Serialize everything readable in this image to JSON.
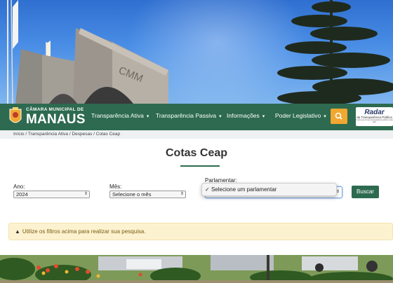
{
  "hero": {
    "building_sign": "CMM"
  },
  "header": {
    "logo": {
      "line1": "CÂMARA MUNICIPAL DE",
      "line2": "MANAUS"
    },
    "nav": [
      {
        "label": "Transparência Ativa"
      },
      {
        "label": "Transparência Passiva"
      },
      {
        "label": "Informações"
      },
      {
        "label": "Poder Legislativo"
      }
    ],
    "radar": {
      "title": "Radar",
      "subtitle": "da Transparência Pública",
      "tagline": "O site que torna a transparência pública mais fácil"
    }
  },
  "breadcrumb": "Início / Transparência Ativa / Despesas / Cotas Ceap",
  "page_title": "Cotas Ceap",
  "filters": {
    "ano": {
      "label": "Ano:",
      "value": "2024"
    },
    "mes": {
      "label": "Mês:",
      "value": "Selecione o mês"
    },
    "parlamentar": {
      "label": "Parlamentar:",
      "selected_option": "Selecione um parlamentar"
    },
    "search_button": "Buscar"
  },
  "alert": {
    "text": "Utilize os filtros acima para realizar sua pesquisa."
  },
  "colors": {
    "nav_green": "#2d6a4f",
    "search_orange": "#f0a830",
    "alert_bg": "#fdf2d0"
  },
  "icons": {
    "search": "search-icon",
    "warning": "warning-icon",
    "check": "check-icon"
  }
}
